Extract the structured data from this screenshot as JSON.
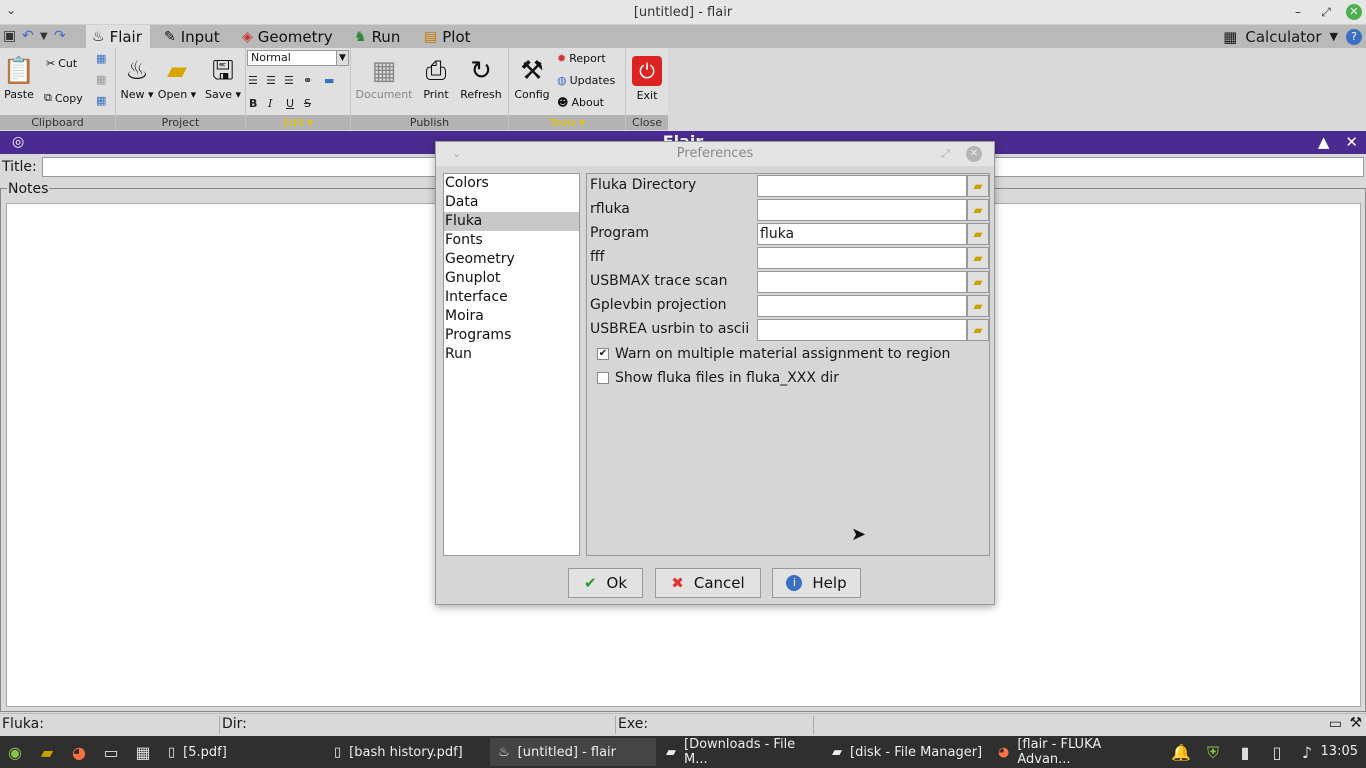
{
  "window": {
    "title": "[untitled] - flair"
  },
  "tabs": [
    {
      "label": "Flair",
      "icon": "pot-icon"
    },
    {
      "label": "Input",
      "icon": "input-icon"
    },
    {
      "label": "Geometry",
      "icon": "geometry-icon"
    },
    {
      "label": "Run",
      "icon": "run-icon"
    },
    {
      "label": "Plot",
      "icon": "plot-icon"
    }
  ],
  "calculator_label": "Calculator",
  "ribbon": {
    "clipboard": {
      "label": "Clipboard",
      "paste": "Paste",
      "cut": "Cut",
      "copy": "Copy"
    },
    "project": {
      "label": "Project",
      "new": "New",
      "open": "Open",
      "save": "Save"
    },
    "edit": {
      "label": "Edit",
      "style": "Normal"
    },
    "publish": {
      "label": "Publish",
      "document": "Document",
      "print": "Print",
      "refresh": "Refresh"
    },
    "tools": {
      "label": "Tools",
      "config": "Config",
      "report": "Report",
      "updates": "Updates",
      "about": "About"
    },
    "close": {
      "label": "Close",
      "exit": "Exit"
    }
  },
  "frame": {
    "title": "Flair",
    "title_label": "Title:",
    "notes_label": "Notes"
  },
  "status": {
    "fluka": "Fluka:",
    "dir": "Dir:",
    "exe": "Exe:"
  },
  "dialog": {
    "title": "Preferences",
    "categories": [
      "Colors",
      "Data",
      "Fluka",
      "Fonts",
      "Geometry",
      "Gnuplot",
      "Interface",
      "Moira",
      "Programs",
      "Run"
    ],
    "selected": "Fluka",
    "fields": [
      {
        "label": "Fluka Directory",
        "value": ""
      },
      {
        "label": "rfluka",
        "value": ""
      },
      {
        "label": "Program",
        "value": "fluka"
      },
      {
        "label": "fff",
        "value": ""
      },
      {
        "label": "USBMAX trace scan",
        "value": ""
      },
      {
        "label": "Gplevbin projection",
        "value": ""
      },
      {
        "label": "USBREA usrbin to ascii",
        "value": ""
      }
    ],
    "checks": [
      {
        "label": "Warn on multiple material assignment to region",
        "checked": true
      },
      {
        "label": "Show fluka files in fluka_XXX dir",
        "checked": false
      }
    ],
    "buttons": {
      "ok": "Ok",
      "cancel": "Cancel",
      "help": "Help"
    }
  },
  "taskbar": {
    "tasks": [
      "[5.pdf]",
      "[bash history.pdf]",
      "[untitled] - flair",
      "[Downloads - File M...",
      "[disk - File Manager]",
      "[flair - FLUKA Advan..."
    ],
    "clock": "13:05"
  }
}
